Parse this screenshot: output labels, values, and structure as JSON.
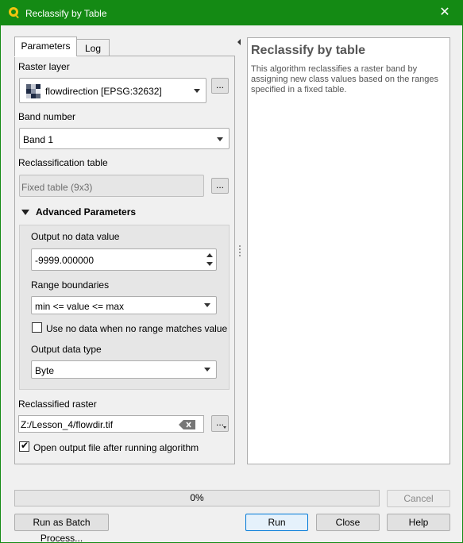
{
  "window": {
    "title": "Reclassify by Table",
    "close_glyph": "✕"
  },
  "tabs": [
    {
      "label": "Parameters"
    },
    {
      "label": "Log"
    }
  ],
  "params": {
    "raster_layer_label": "Raster layer",
    "raster_layer_value": "flowdirection [EPSG:32632]",
    "band_label": "Band number",
    "band_value": "Band 1",
    "table_label": "Reclassification table",
    "table_value": "Fixed table (9x3)",
    "advanced_label": "Advanced Parameters",
    "nodata_label": "Output no data value",
    "nodata_value": "-9999.000000",
    "range_label": "Range boundaries",
    "range_value": "min <= value <= max",
    "use_nodata_label": "Use no data when no range matches value",
    "dtype_label": "Output data type",
    "dtype_value": "Byte",
    "output_label": "Reclassified raster",
    "output_value": "Z:/Lesson_4/flowdir.tif",
    "open_output_label": "Open output file after running algorithm",
    "dots": "..."
  },
  "help": {
    "title": "Reclassify by table",
    "body": "This algorithm reclassifies a raster band by assigning new class values based on the ranges specified in a fixed table."
  },
  "footer": {
    "progress_text": "0%",
    "progress": 0,
    "cancel": "Cancel",
    "batch": "Run as Batch Process...",
    "run": "Run",
    "close": "Close",
    "help": "Help"
  },
  "colors": {
    "titlebar": "#148a14",
    "accent": "#0078d7"
  }
}
